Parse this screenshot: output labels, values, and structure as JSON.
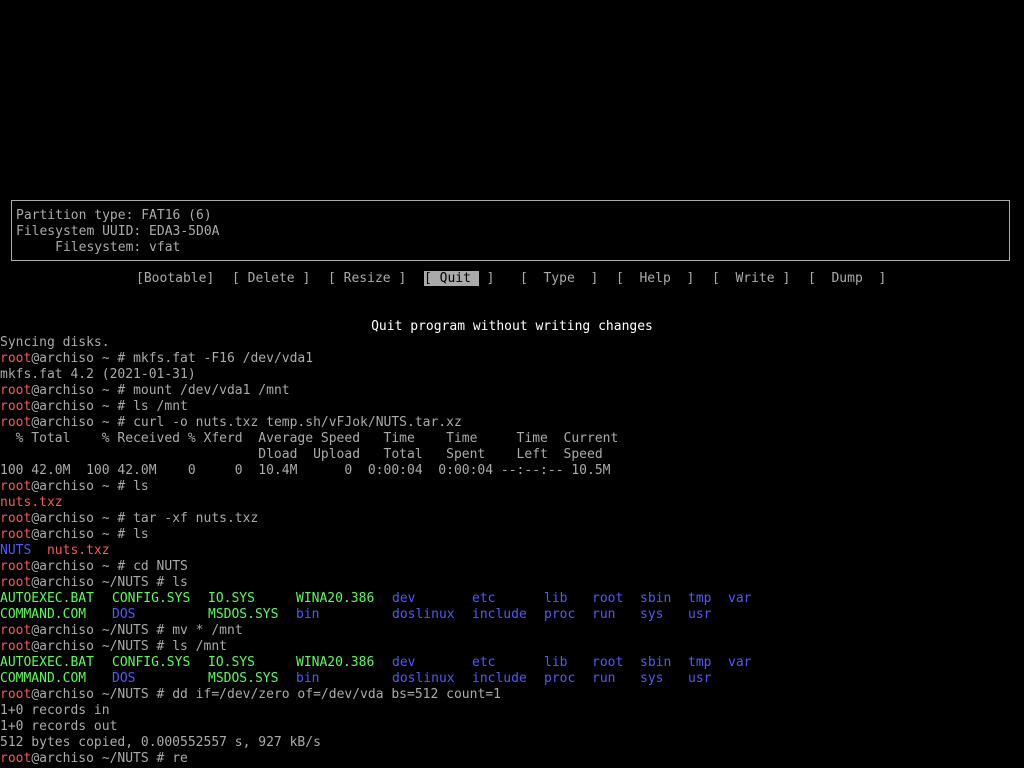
{
  "info": {
    "partition_type": "Partition type: FAT16 (6)",
    "filesystem_uuid": "Filesystem UUID: EDA3-5D0A",
    "filesystem": "     Filesystem: vfat"
  },
  "menu": {
    "bootable": "[Bootable]",
    "delete": "[ Delete ]",
    "resize": "[ Resize ]",
    "quit_open": "[",
    "quit_label": " Quit ",
    "quit_close": "]",
    "type": "[  Type  ]",
    "help": "[  Help  ]",
    "write": "[  Write ]",
    "dump": "[  Dump  ]"
  },
  "status_message": "Quit program without writing changes",
  "colors": {
    "user": "#ff5555",
    "executable": "#55ff55",
    "directory": "#5555ff",
    "text": "#aaaaaa"
  },
  "terminal": {
    "user": "root",
    "host_home": "@archiso ~ # ",
    "host_nuts": "@archiso ~/NUTS # ",
    "l0": "Syncing disks.",
    "c1": "mkfs.fat -F16 /dev/vda1",
    "l2": "mkfs.fat 4.2 (2021-01-31)",
    "c3": "mount /dev/vda1 /mnt",
    "c4": "ls /mnt",
    "c5": "curl -o nuts.txz temp.sh/vFJok/NUTS.tar.xz",
    "curl_h1": "  % Total    % Received % Xferd  Average Speed   Time    Time     Time  Current",
    "curl_h2": "                                 Dload  Upload   Total   Spent    Left  Speed",
    "curl_r": "100 42.0M  100 42.0M    0     0  10.4M      0  0:00:04  0:00:04 --:--:-- 10.5M",
    "c9": "ls",
    "f10": "nuts.txz",
    "c11": "tar -xf nuts.txz",
    "c12": "ls",
    "f13a": "NUTS",
    "f13b": "nuts.txz",
    "c14": "cd NUTS",
    "c15": "ls",
    "c18": "mv * /mnt",
    "c19": "ls /mnt",
    "c22": "dd if=/dev/zero of=/dev/vda bs=512 count=1",
    "l23": "1+0 records in",
    "l24": "1+0 records out",
    "l25": "512 bytes copied, 0.000552557 s, 927 kB/s",
    "c26": "re",
    "listing": {
      "row1": [
        "AUTOEXEC.BAT",
        "CONFIG.SYS",
        "IO.SYS",
        "WINA20.386",
        "dev",
        "etc",
        "lib",
        "root",
        "sbin",
        "tmp",
        "var"
      ],
      "row2": [
        "COMMAND.COM",
        "DOS",
        "MSDOS.SYS",
        "bin",
        "doslinux",
        "include",
        "proc",
        "run",
        "sys",
        "usr"
      ]
    }
  }
}
